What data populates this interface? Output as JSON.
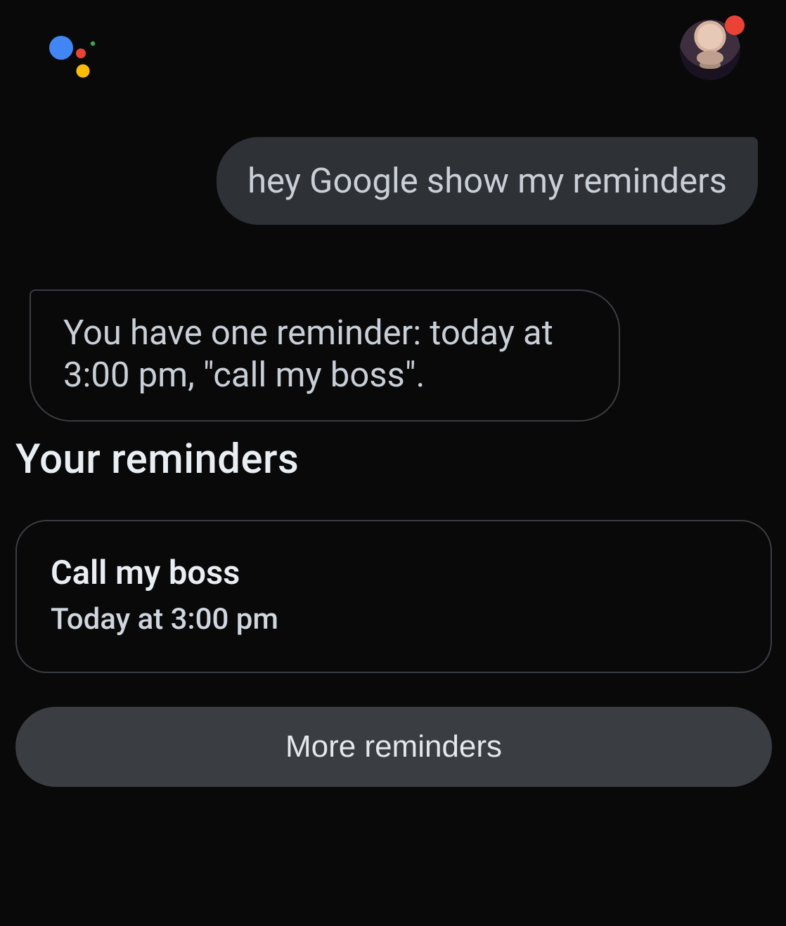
{
  "header": {
    "logo_icon": "google-assistant-icon",
    "avatar_icon": "user-avatar",
    "notification_dot_color": "#ea4335"
  },
  "conversation": {
    "user_message": "hey Google show my reminders",
    "assistant_message": "You have one reminder: today at 3:00 pm, \"call my boss\"."
  },
  "reminders_section": {
    "title": "Your reminders",
    "items": [
      {
        "title": "Call my boss",
        "time": "Today at 3:00 pm"
      }
    ],
    "more_button_label": "More reminders"
  }
}
